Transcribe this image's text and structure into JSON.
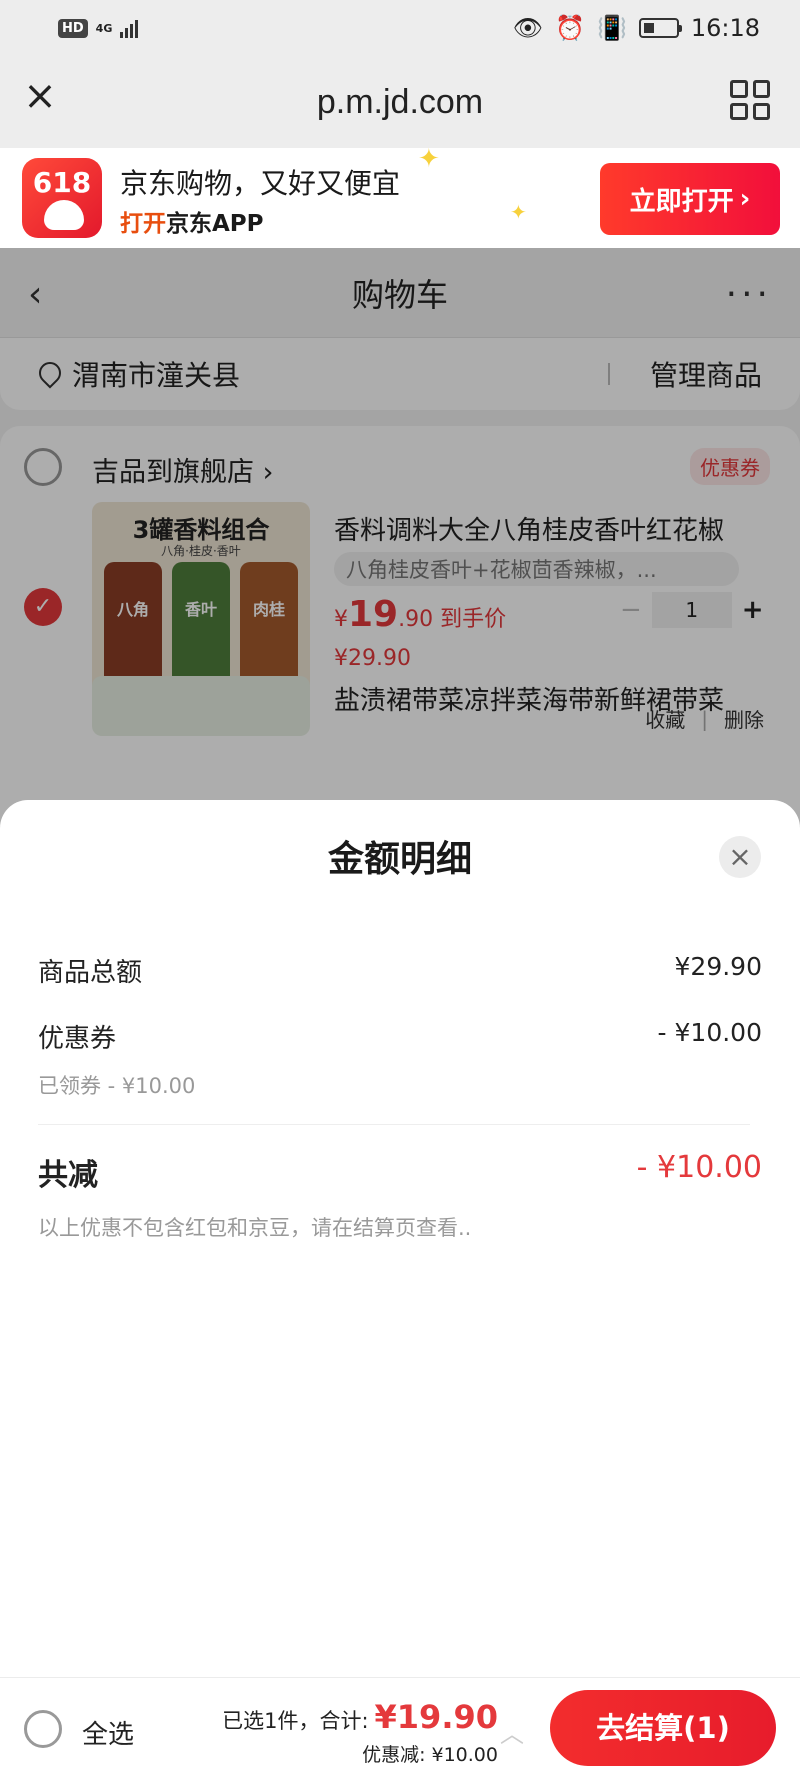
{
  "status_bar": {
    "hd": "HD",
    "network": "4G",
    "time": "16:18"
  },
  "browser": {
    "domain": "p.m.jd.com"
  },
  "app_banner": {
    "logo_text": "618",
    "tagline": "京东购物，又好又便宜",
    "open_prefix": "打开",
    "open_suffix": "京东APP",
    "open_button": "立即打开"
  },
  "nav": {
    "title": "购物车"
  },
  "address": {
    "location": "渭南市潼关县",
    "manage": "管理商品"
  },
  "store": {
    "name": "吉品到旗舰店 ›",
    "coupon_tag": "优惠券",
    "product": {
      "image_title": "3罐香料组合",
      "image_subtitle": "八角·桂皮·香叶",
      "jars": [
        "八角",
        "香叶",
        "肉桂"
      ],
      "title": "香料调料大全八角桂皮香叶红花椒",
      "spec": "八角桂皮香叶+花椒茴香辣椒，...",
      "price_symbol": "¥",
      "price_int": "19",
      "price_dec": ".90",
      "price_label": "到手价",
      "original_price": "¥29.90",
      "quantity": "1",
      "favorite": "收藏",
      "delete": "删除"
    },
    "product2": {
      "title": "盐渍裙带菜凉拌菜海带新鲜裙带菜"
    }
  },
  "sheet": {
    "title": "金额明细",
    "rows": {
      "goods_total_label": "商品总额",
      "goods_total_value": "¥29.90",
      "coupon_label": "优惠券",
      "coupon_value": "- ¥10.00",
      "coupon_sub": "已领券 - ¥10.00",
      "total_discount_label": "共减",
      "total_discount_value": "- ¥10.00"
    },
    "note": "以上优惠不包含红包和京豆，请在结算页查看.."
  },
  "footer": {
    "select_all": "全选",
    "selected_text": "已选1件，合计:",
    "total": "¥19.90",
    "discount_text": "优惠减: ¥10.00",
    "checkout": "去结算(1)"
  },
  "colors": {
    "accent": "#e4393c",
    "banner_button": "#f2203a"
  }
}
